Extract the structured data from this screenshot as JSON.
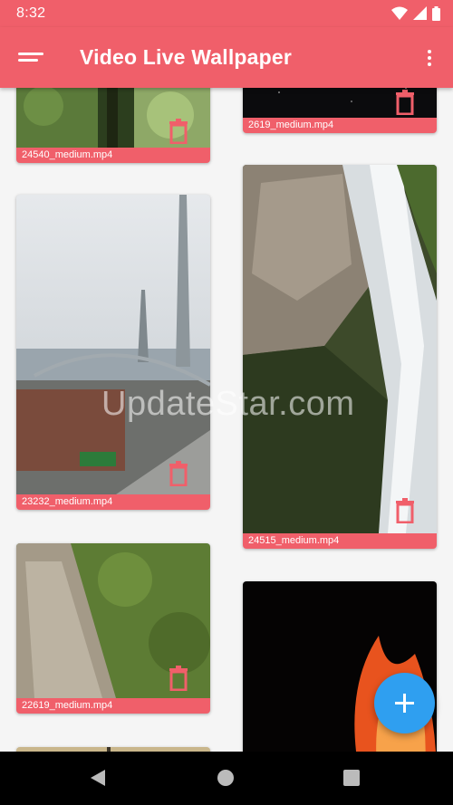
{
  "status": {
    "time": "8:32"
  },
  "appbar": {
    "title": "Video Live Wallpaper"
  },
  "videos": [
    {
      "name": "24540_medium.mp4"
    },
    {
      "name": "2619_medium.mp4"
    },
    {
      "name": "23232_medium.mp4"
    },
    {
      "name": "24515_medium.mp4"
    },
    {
      "name": "22619_medium.mp4"
    },
    {
      "name": ""
    },
    {
      "name": ""
    }
  ],
  "watermark": "UpdateStar.com",
  "colors": {
    "primary": "#f05f6a",
    "fab": "#2f9ff0"
  },
  "icons": [
    "menu-icon",
    "more-vert-icon",
    "trash-icon",
    "add-icon",
    "back-icon",
    "home-icon",
    "recents-icon",
    "wifi-icon",
    "signal-icon",
    "battery-icon"
  ]
}
